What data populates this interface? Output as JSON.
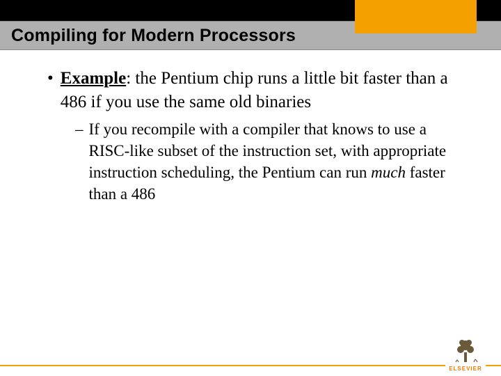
{
  "title": "Compiling for Modern Processors",
  "bullet": {
    "label": "Example",
    "text": ": the Pentium chip runs a little bit faster than a 486 if you use the same old binaries",
    "sub": {
      "pre": "If you recompile with a compiler that knows to use a RISC-like subset of the instruction set, with appropriate instruction scheduling, the Pentium can run ",
      "emph": "much",
      "post": " faster than a 486"
    }
  },
  "logo": {
    "brand": "ELSEVIER"
  }
}
